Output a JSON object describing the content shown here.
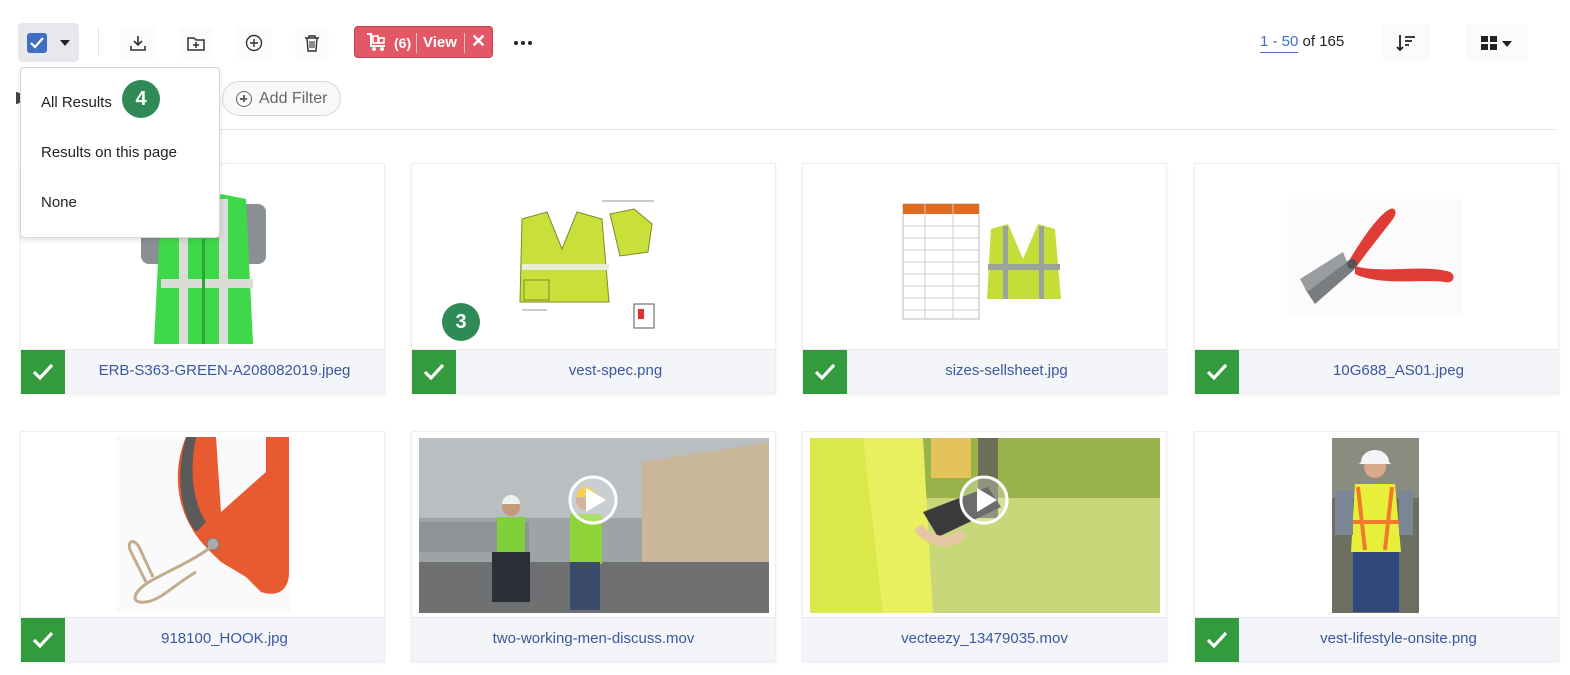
{
  "toolbar": {
    "select_all_checked": true,
    "icons": [
      "download-icon",
      "add-to-folder-icon",
      "add-icon",
      "trash-icon"
    ],
    "cart": {
      "count": "(6)",
      "view_label": "View",
      "close_label": "✕"
    },
    "more_label": "•••",
    "pager": {
      "range": "1 - 50",
      "of_text": "of 165"
    }
  },
  "filters": {
    "add_filter_label": "Add Filter"
  },
  "select_menu": {
    "items": [
      "All Results",
      "Results on this page",
      "None"
    ]
  },
  "badges": {
    "select_menu_badge": "4",
    "card_badge": "3"
  },
  "assets": [
    {
      "name": "ERB-S363-GREEN-A208082019.jpeg",
      "selected": true,
      "kind": "image"
    },
    {
      "name": "vest-spec.png",
      "selected": true,
      "kind": "image"
    },
    {
      "name": "sizes-sellsheet.jpg",
      "selected": true,
      "kind": "image"
    },
    {
      "name": "10G688_AS01.jpeg",
      "selected": true,
      "kind": "image"
    },
    {
      "name": "918100_HOOK.jpg",
      "selected": true,
      "kind": "image"
    },
    {
      "name": "two-working-men-discuss.mov",
      "selected": false,
      "kind": "video"
    },
    {
      "name": "vecteezy_13479035.mov",
      "selected": false,
      "kind": "video"
    },
    {
      "name": "vest-lifestyle-onsite.png",
      "selected": true,
      "kind": "image"
    }
  ],
  "colors": {
    "accent": "#3f6fc2",
    "cart": "#e25866",
    "selected_check": "#339b3d",
    "badge": "#2f8a56"
  }
}
